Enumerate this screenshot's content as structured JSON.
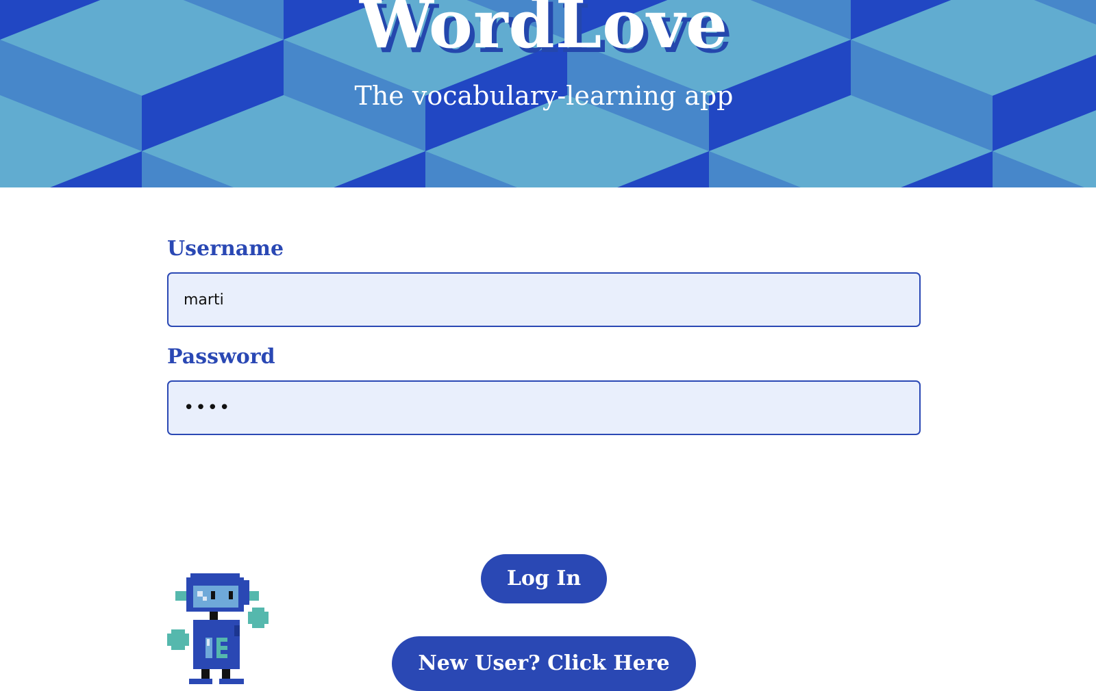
{
  "header": {
    "title": "WordLove",
    "subtitle": "The vocabulary-learning app",
    "colors": {
      "dark_blue": "#2147c3",
      "mid_blue": "#4787ca",
      "light_blue": "#61acd0"
    }
  },
  "form": {
    "username_label": "Username",
    "username_value": "marti",
    "password_label": "Password",
    "password_value": "••••"
  },
  "buttons": {
    "login_label": "Log In",
    "register_label": "New User? Click Here"
  },
  "mascot": {
    "icon": "robot-mascot-icon"
  },
  "colors": {
    "accent": "#2a48b4",
    "input_bg": "#e9effc"
  }
}
